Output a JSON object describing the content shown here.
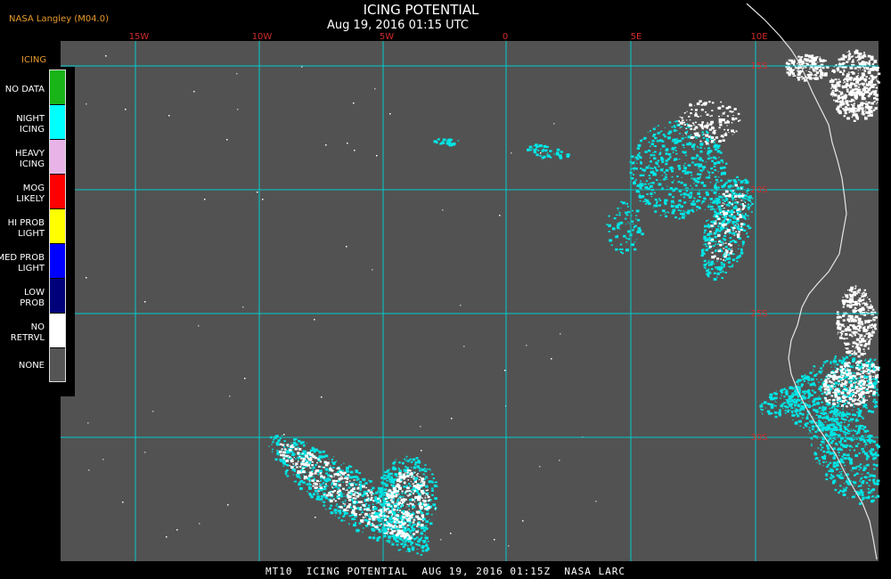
{
  "header": {
    "producer": "NASA Langley (M04.0)",
    "title": "ICING POTENTIAL",
    "subtitle": "Aug 19, 2016 01:15 UTC"
  },
  "legend": {
    "header": "ICING",
    "items": [
      {
        "label": "NO DATA",
        "color": "#18b418"
      },
      {
        "label": "NIGHT\nICING",
        "color": "#00ffff"
      },
      {
        "label": "HEAVY\nICING",
        "color": "#e8b4e8"
      },
      {
        "label": "MOG\nLIKELY",
        "color": "#ff0000"
      },
      {
        "label": "HI PROB\nLIGHT",
        "color": "#ffff00"
      },
      {
        "label": "MED PROB\nLIGHT",
        "color": "#0000ff"
      },
      {
        "label": "LOW\nPROB",
        "color": "#00007a"
      },
      {
        "label": "NO\nRETRVL",
        "color": "#ffffff"
      },
      {
        "label": "NONE",
        "color": "#555555"
      }
    ]
  },
  "map": {
    "longitude_labels": [
      "15W",
      "10W",
      "5W",
      "0",
      "5E",
      "10E"
    ],
    "latitude_labels": [
      "15S",
      "20S",
      "25S",
      "30S"
    ],
    "colors": {
      "background": "#525252",
      "grid": "#00cccc",
      "coast": "#e6e6e6",
      "cloud": "#00e5e5",
      "snow": "#ffffff"
    }
  },
  "footer": "MT10  ICING POTENTIAL  AUG 19, 2016 01:15Z  NASA LARC"
}
